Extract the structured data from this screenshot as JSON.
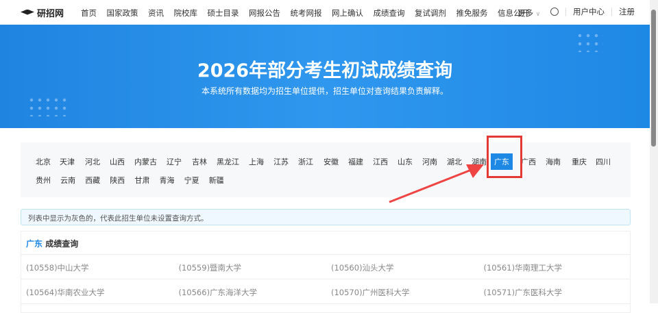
{
  "header": {
    "logo": "研招网",
    "nav": [
      "首页",
      "国家政策",
      "资讯",
      "院校库",
      "硕士目录",
      "网报公告",
      "统考网报",
      "网上确认",
      "成绩查询",
      "复试调剂",
      "推免服务",
      "信息公开"
    ],
    "more": "更多",
    "user_center": "用户中心",
    "register": "注册"
  },
  "banner": {
    "title": "2026年部分考生初试成绩查询",
    "subtitle": "本系统所有数据均为招生单位提供，招生单位对查询结果负责解释。"
  },
  "provinces": [
    "北京",
    "天津",
    "河北",
    "山西",
    "内蒙古",
    "辽宁",
    "吉林",
    "黑龙江",
    "上海",
    "江苏",
    "浙江",
    "安徽",
    "福建",
    "江西",
    "山东",
    "河南",
    "湖北",
    "湖南",
    "广东",
    "广西",
    "海南",
    "重庆",
    "四川",
    "贵州",
    "云南",
    "西藏",
    "陕西",
    "甘肃",
    "青海",
    "宁夏",
    "新疆"
  ],
  "selected_province": "广东",
  "notice": "列表中显示为灰色的，代表此招生单位未设置查询方式。",
  "results": {
    "province": "广东",
    "title": "成绩查询",
    "schools": [
      [
        "(10558)中山大学",
        "(10559)暨南大学",
        "(10560)汕头大学",
        "(10561)华南理工大学"
      ],
      [
        "(10564)华南农业大学",
        "(10566)广东海洋大学",
        "(10570)广州医科大学",
        "(10571)广东医科大学"
      ]
    ]
  }
}
